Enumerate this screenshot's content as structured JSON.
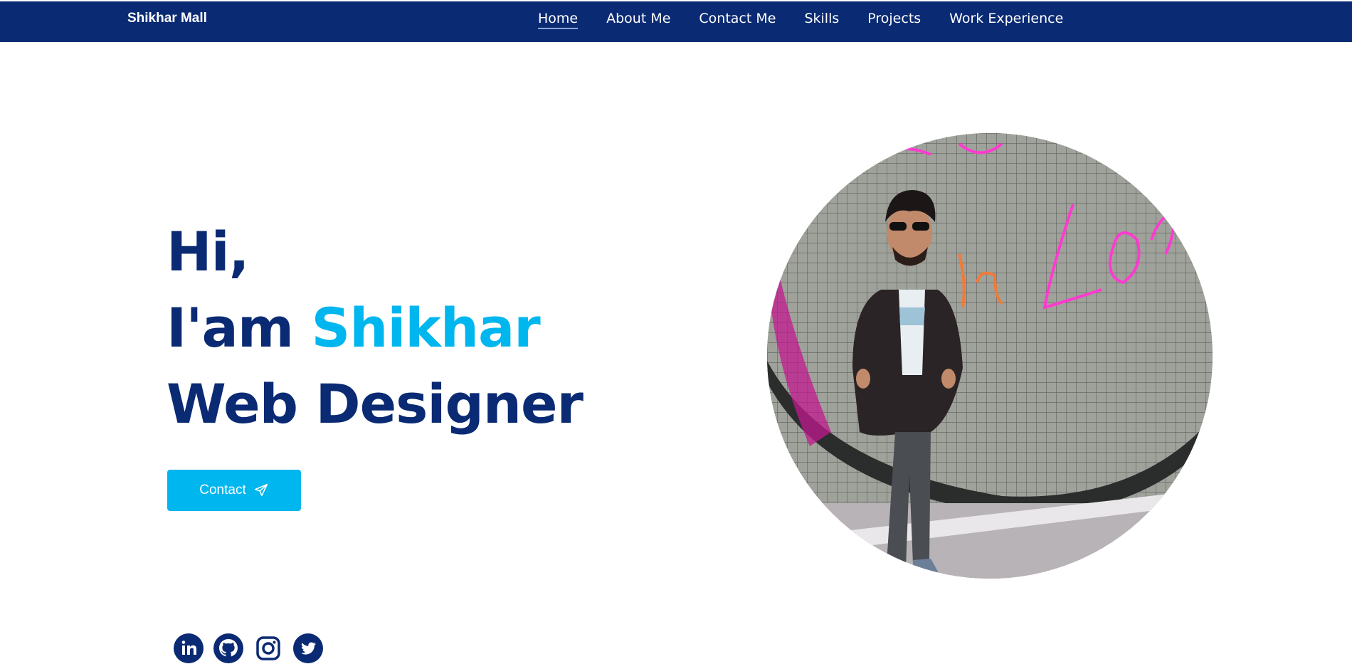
{
  "header": {
    "brand": "Shikhar Mall",
    "nav": [
      {
        "label": "Home",
        "active": true
      },
      {
        "label": "About Me"
      },
      {
        "label": "Contact Me"
      },
      {
        "label": "Skills"
      },
      {
        "label": "Projects"
      },
      {
        "label": "Work Experience"
      }
    ]
  },
  "hero": {
    "line1": "Hi,",
    "line2_prefix": "I'am ",
    "line2_name": "Shikhar",
    "line3": "Web Designer",
    "contact_button": "Contact"
  },
  "icons": {
    "contact": "send-icon",
    "socials": [
      "linkedin-icon",
      "github-icon",
      "instagram-icon",
      "twitter-icon"
    ]
  },
  "colors": {
    "navbar": "#0a2a73",
    "primary_text": "#0a2a73",
    "accent": "#00b6ef",
    "background": "#ffffff"
  }
}
